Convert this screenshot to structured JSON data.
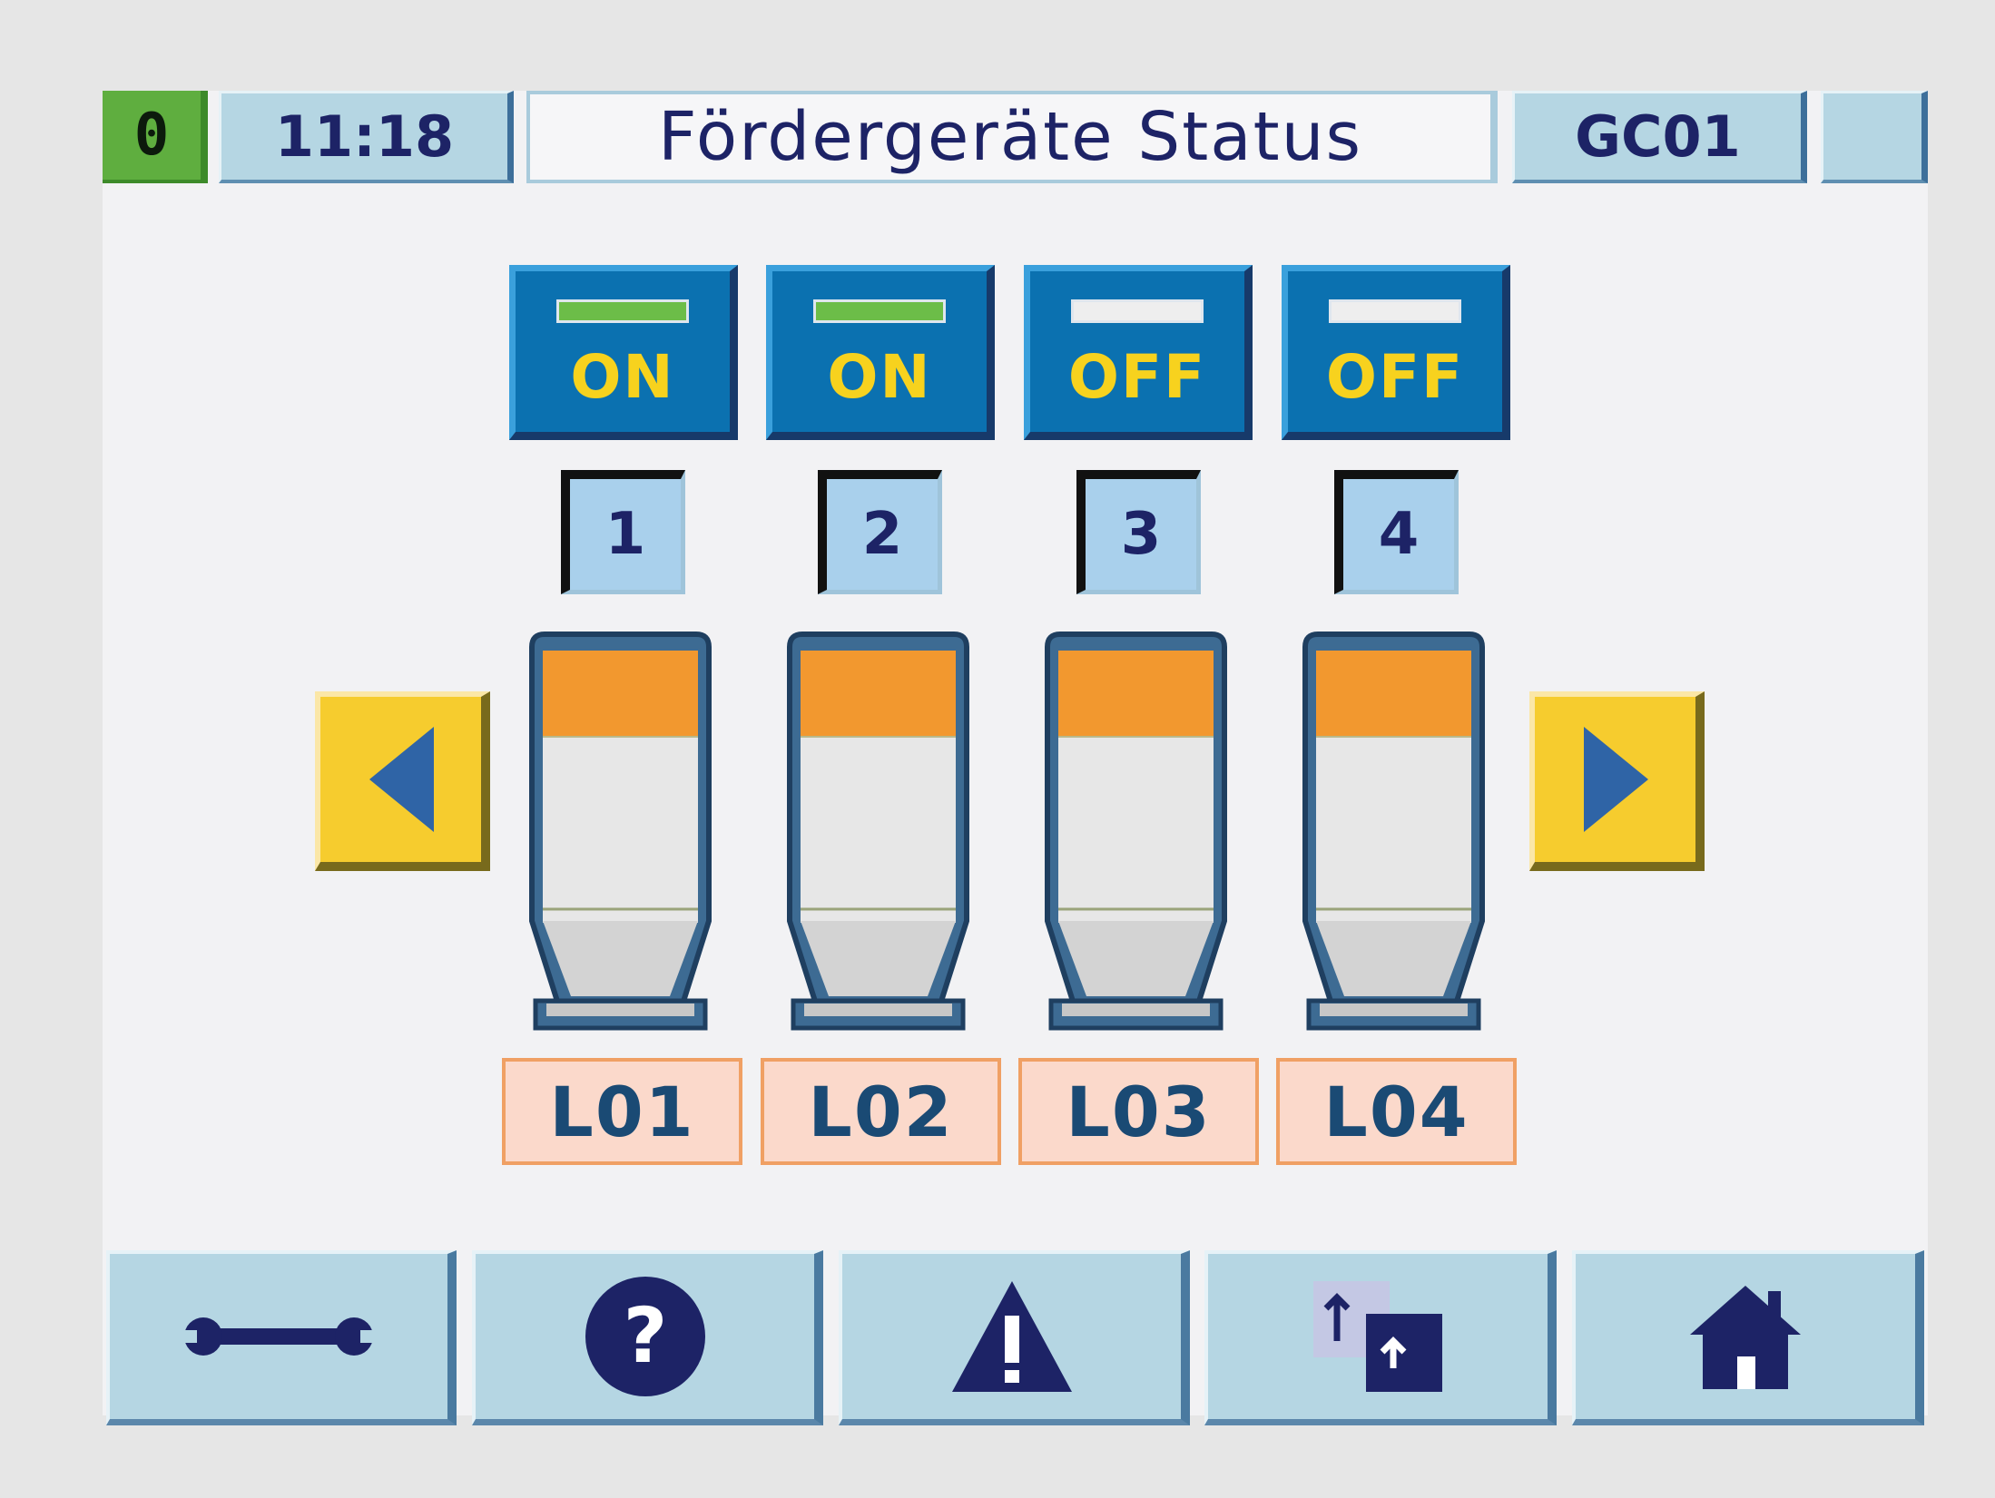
{
  "header": {
    "counter": "0",
    "time": "11:18",
    "title": "Fördergeräte Status",
    "station": "GC01"
  },
  "loaders": [
    {
      "switch_label": "ON",
      "led": "on",
      "number": "1",
      "name": "L01"
    },
    {
      "switch_label": "ON",
      "led": "on",
      "number": "2",
      "name": "L02"
    },
    {
      "switch_label": "OFF",
      "led": "off",
      "number": "3",
      "name": "L03"
    },
    {
      "switch_label": "OFF",
      "led": "off",
      "number": "4",
      "name": "L04"
    }
  ],
  "navigation": {
    "prev_icon": "arrow-left-icon",
    "next_icon": "arrow-right-icon"
  },
  "toolbar": [
    {
      "icon": "wrench-icon"
    },
    {
      "icon": "help-icon"
    },
    {
      "icon": "warning-icon"
    },
    {
      "icon": "switch-screen-icon"
    },
    {
      "icon": "home-icon"
    }
  ],
  "colors": {
    "led_on": "#6cbd48",
    "led_off": "#eeeeee",
    "switch_bg": "#0b71b0",
    "switch_text": "#f7d21e",
    "hopper_level": "#f2982f",
    "arrow_bg": "#f6cc2e",
    "toolbar_bg": "#b5d6e3"
  }
}
